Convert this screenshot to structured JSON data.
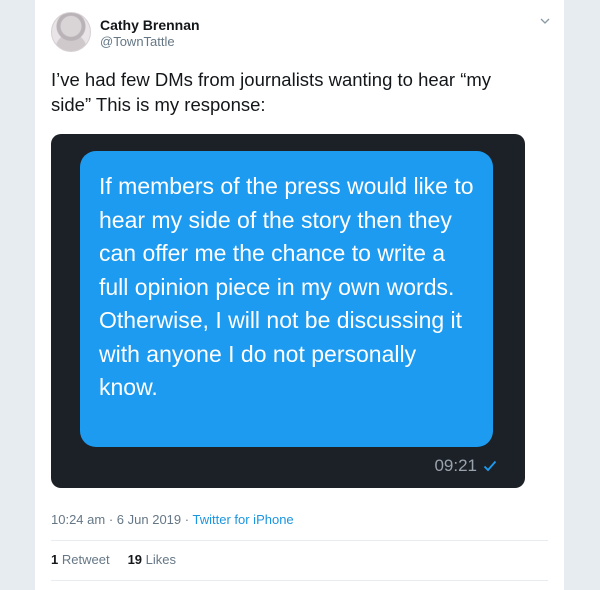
{
  "user": {
    "name": "Cathy Brennan",
    "handle": "@TownTattle"
  },
  "tweet": {
    "text": "I’ve had few DMs from journalists wanting to hear “my side” This is my response:"
  },
  "media": {
    "bubble_text": "If members of the press would like to hear my side of the story then they can offer me the chance to write a full opinion piece in my own words. Otherwise, I will not be discussing it with anyone I do not personally know.",
    "time": "09:21"
  },
  "meta": {
    "time": "10:24 am",
    "separator": "·",
    "date": "6 Jun 2019",
    "source": "Twitter for iPhone"
  },
  "stats": {
    "retweets_count": "1",
    "retweets_label": "Retweet",
    "likes_count": "19",
    "likes_label": "Likes"
  },
  "colors": {
    "bubble": "#1d9bf0",
    "link": "#1b95e0",
    "media_bg": "#1c2127"
  }
}
